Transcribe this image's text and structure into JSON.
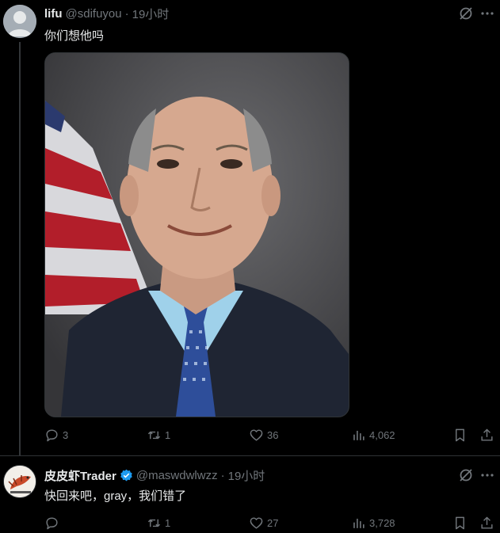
{
  "tweets": [
    {
      "name": "lifu",
      "handle": "@sdifuyou",
      "separator": "·",
      "time": "19小时",
      "text": "你们想他吗",
      "replies": "3",
      "retweets": "1",
      "likes": "36",
      "views": "4,062"
    },
    {
      "name": "皮皮虾Trader",
      "handle": "@maswdwlwzz",
      "separator": "·",
      "time": "19小时",
      "text": "快回来吧，gray，我们错了",
      "replies": "",
      "retweets": "1",
      "likes": "27",
      "views": "3,728"
    }
  ],
  "colors": {
    "background": "#000000",
    "text_primary": "#e7e9ea",
    "text_secondary": "#71767b",
    "verified_blue": "#1d9bf0",
    "divider": "#2f3336"
  },
  "icons": {
    "reply": "reply-icon",
    "retweet": "retweet-icon",
    "like": "like-icon",
    "views": "views-icon",
    "bookmark": "bookmark-icon",
    "share": "share-icon",
    "grok": "grok-icon",
    "more": "more-icon",
    "verified": "verified-badge-icon"
  }
}
